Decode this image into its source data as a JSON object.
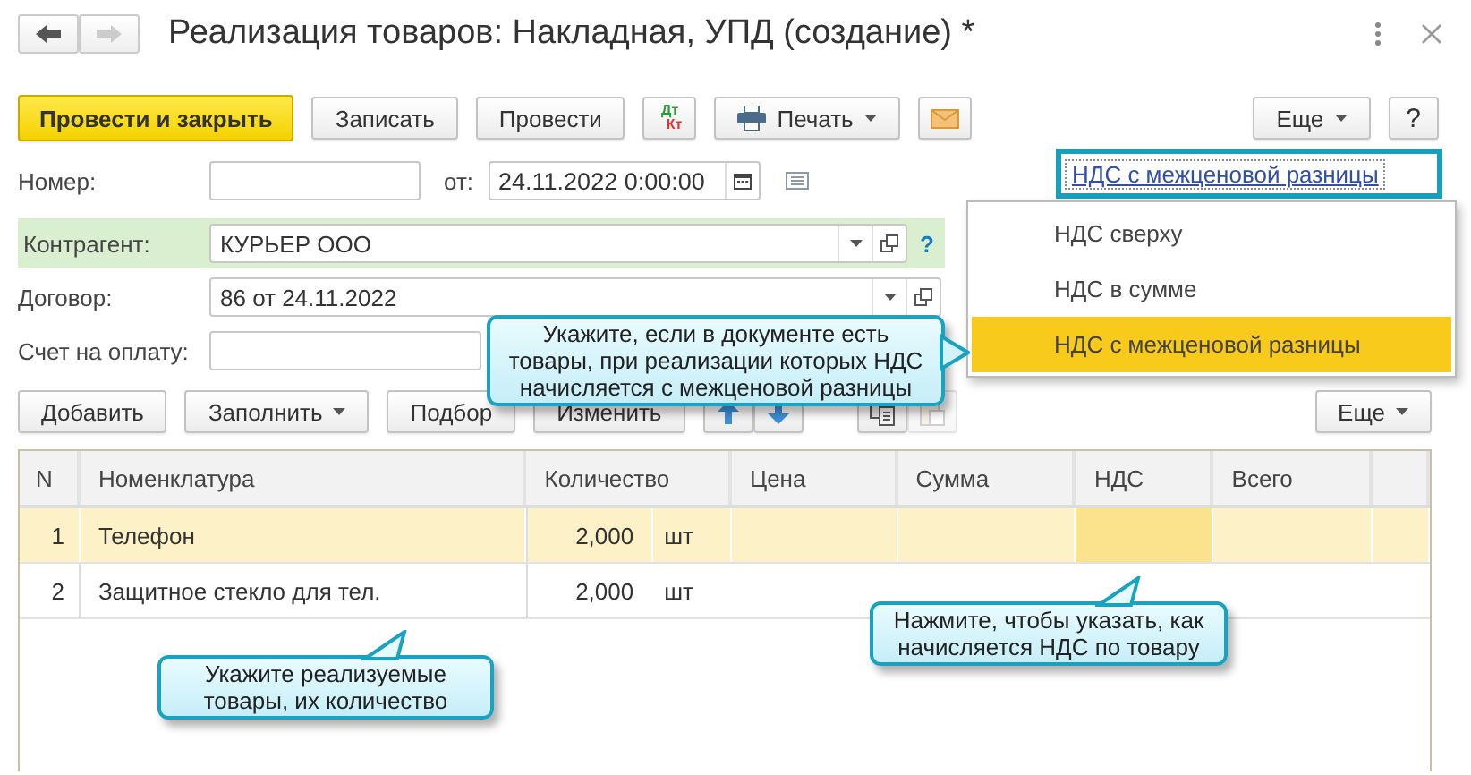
{
  "window": {
    "title": "Реализация товаров: Накладная, УПД (создание) *"
  },
  "nav": {
    "back_disabled": false,
    "forward_disabled": true
  },
  "toolbar": [
    {
      "kind": "primary",
      "label": "Провести и закрыть"
    },
    {
      "kind": "button",
      "label": "Записать"
    },
    {
      "kind": "button",
      "label": "Провести"
    },
    {
      "kind": "dtkt",
      "label_top": "Дт",
      "label_bottom": "Кт"
    },
    {
      "kind": "print",
      "label": "Печать"
    },
    {
      "kind": "mail"
    }
  ],
  "toolbar_right": [
    {
      "kind": "menu",
      "label": "Еще"
    },
    {
      "kind": "button",
      "label": "?"
    }
  ],
  "number": {
    "label": "Номер:",
    "date_label": "от:",
    "date": "24.11.2022  0:00:00"
  },
  "vat_link": {
    "label": "НДС с межценовой разницы",
    "highlighted": true
  },
  "counterparty": {
    "label": "Контрагент:",
    "value": "КУРЬЕР ООО",
    "highlighted": true,
    "help": "?"
  },
  "contract": {
    "label": "Договор:",
    "value": "86 от 24.11.2022"
  },
  "invoice": {
    "label": "Счет на оплату:"
  },
  "table_toolbar": [
    {
      "kind": "button",
      "label": "Добавить"
    },
    {
      "kind": "menu",
      "label": "Заполнить"
    },
    {
      "kind": "button",
      "label": "Подбор"
    },
    {
      "kind": "button",
      "label": "Изменить"
    },
    {
      "kind": "up"
    },
    {
      "kind": "down"
    },
    {
      "kind": "copy",
      "disabled": false
    },
    {
      "kind": "paste",
      "disabled": true
    }
  ],
  "table_toolbar_right": {
    "label": "Еще"
  },
  "table": {
    "columns": [
      "N",
      "Номенклатура",
      "Количество",
      "Цена",
      "Сумма",
      "НДС",
      "Всего"
    ],
    "rows": [
      {
        "n": "1",
        "item": "Телефон",
        "quantity": "2,000",
        "unit": "шт",
        "selected": true,
        "vat_cell_focused": true
      },
      {
        "n": "2",
        "item": "Защитное стекло для тел.",
        "quantity": "2,000",
        "unit": "шт",
        "selected": false,
        "vat_cell_focused": false
      }
    ]
  },
  "dropdown": [
    {
      "label": "НДС сверху",
      "selected": false
    },
    {
      "label": "НДС в сумме",
      "selected": false
    },
    {
      "label": "НДС с межценовой разницы",
      "selected": true
    }
  ],
  "callouts": [
    {
      "kind": "right",
      "text": "Укажите, если в документе есть товары, при реализации которых НДС начисляется с межценовой разницы"
    },
    {
      "kind": "up",
      "text": "Укажите реализуемые товары, их количество"
    },
    {
      "kind": "up",
      "text": "Нажмите, чтобы указать, как начисляется НДС по товару"
    }
  ]
}
